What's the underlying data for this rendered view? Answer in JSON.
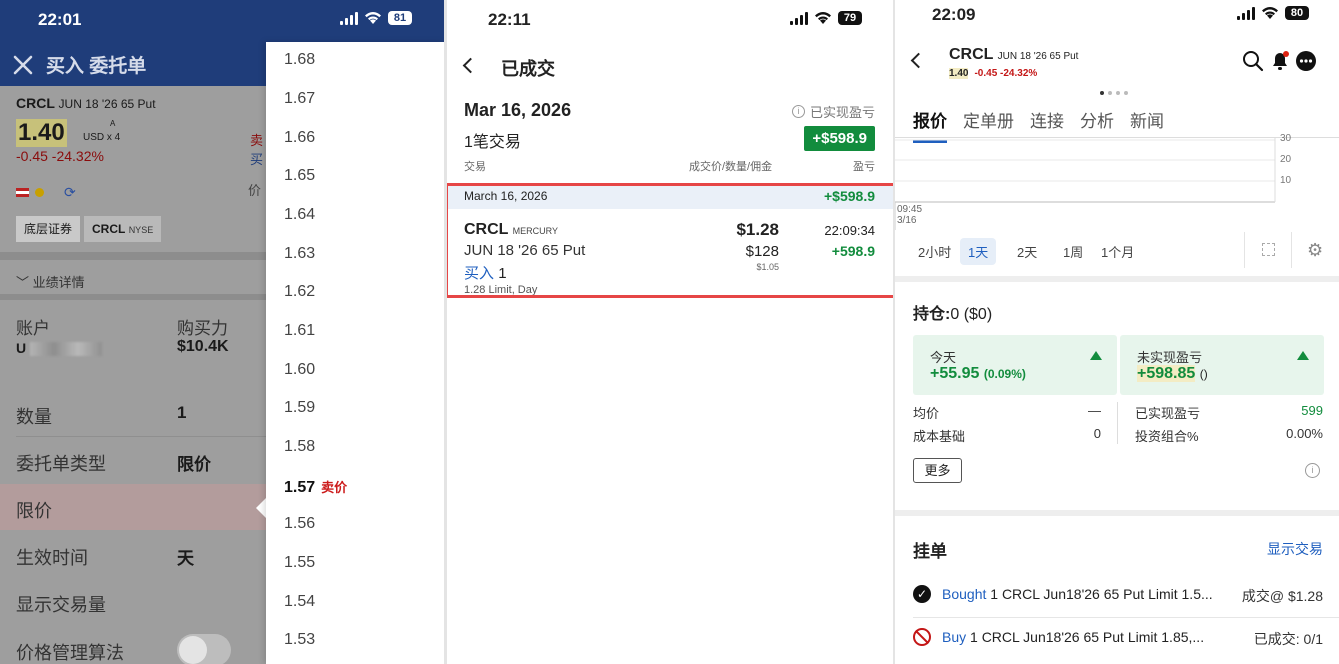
{
  "panel1": {
    "status": {
      "time": "22:01",
      "battery": "81"
    },
    "title": "买入 委托单",
    "symbol": "CRCL",
    "contract": "JUN 18 '26 65 Put",
    "price": "1.40",
    "price_flag": "A",
    "currency": "USD x 4",
    "change": "-0.45 -24.32%",
    "trunc_sell": "卖",
    "trunc_buy": "买",
    "trunc_price": "价",
    "tab_underlying": "底层证券",
    "tab_symbol": "CRCL",
    "tab_exchange": "NYSE",
    "performance": "业绩详情",
    "account_label": "账户",
    "account_value": "U",
    "buying_power_label": "购买力",
    "buying_power_value": "$10.4K",
    "fields": [
      {
        "label": "数量",
        "value": "1"
      },
      {
        "label": "委托单类型",
        "value": "限价"
      },
      {
        "label": "限价",
        "value": ""
      },
      {
        "label": "生效时间",
        "value": "天"
      },
      {
        "label": "显示交易量",
        "value": ""
      },
      {
        "label": "价格管理算法",
        "value": ""
      }
    ],
    "picker": [
      "1.68",
      "1.67",
      "1.66",
      "1.65",
      "1.64",
      "1.63",
      "1.62",
      "1.61",
      "1.60",
      "1.59",
      "1.58",
      "1.57",
      "1.56",
      "1.55",
      "1.54",
      "1.53"
    ],
    "picker_selected_index": 11,
    "picker_ask_label": "卖价"
  },
  "panel2": {
    "status": {
      "time": "22:11",
      "battery": "79"
    },
    "title": "已成交",
    "date": "Mar 16, 2026",
    "trade_count": "1笔交易",
    "realized_label": "已实现盈亏",
    "realized_value": "+$598.9",
    "header_trade": "交易",
    "header_fill": "成交价/数量/佣金",
    "header_pl": "盈亏",
    "group_date": "March 16, 2026",
    "group_pl": "+$598.9",
    "trade": {
      "symbol": "CRCL",
      "exchange": "MERCURY",
      "description": "JUN 18 '26 65 Put",
      "side": "买入",
      "qty": "1",
      "order_detail": "1.28 Limit, Day",
      "fill_price": "$1.28",
      "amount": "$128",
      "commission": "$1.05",
      "time": "22:09:34",
      "pl": "+598.9"
    }
  },
  "panel3": {
    "status": {
      "time": "22:09",
      "battery": "80"
    },
    "symbol": "CRCL",
    "contract": "JUN 18 '26 65 Put",
    "price": "1.40",
    "change": "-0.45 -24.32%",
    "tabs": [
      "报价",
      "定单册",
      "连接",
      "分析",
      "新闻"
    ],
    "chart_y_ticks": [
      "30",
      "20",
      "10"
    ],
    "chart_x_time": "09:45",
    "chart_x_date": "3/16",
    "ranges": [
      "2小时",
      "1天",
      "2天",
      "1周",
      "1个月"
    ],
    "active_range": 1,
    "position_label": "持仓:",
    "position_value": "0 ($0)",
    "today_label": "今天",
    "today_value": "+55.95",
    "today_pct": "(0.09%)",
    "unrealized_label": "未实现盈亏",
    "unrealized_value": "+598.85",
    "unrealized_extra": "()",
    "avg_price_label": "均价",
    "avg_price_value": "—",
    "cost_basis_label": "成本基础",
    "cost_basis_value": "0",
    "realized_label": "已实现盈亏",
    "realized_value": "599",
    "portfolio_pct_label": "投资组合%",
    "portfolio_pct_value": "0.00%",
    "more": "更多",
    "orders_title": "挂单",
    "show_trades": "显示交易",
    "orders": [
      {
        "action": "Bought",
        "text": "1 CRCL Jun18'26 65 Put Limit 1.5...",
        "status": "成交@ $1.28"
      },
      {
        "action": "Buy",
        "text": "1 CRCL Jun18'26 65 Put Limit 1.85,...",
        "status": "已成交: 0/1"
      }
    ]
  }
}
